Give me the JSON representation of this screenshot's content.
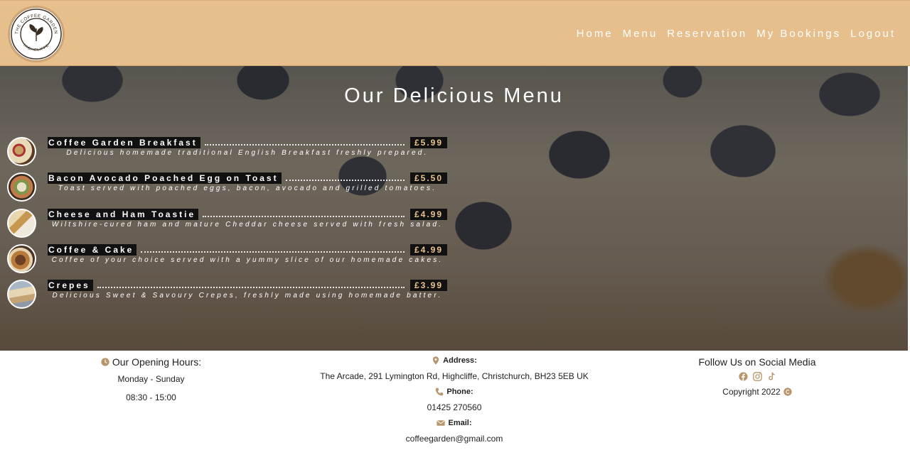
{
  "header": {
    "logo": {
      "top_text": "THE COFFEE GARDEN",
      "bottom_text": "HIGHCLIFFE",
      "icon": "leaf-icon"
    },
    "nav": [
      {
        "label": "Home"
      },
      {
        "label": "Menu"
      },
      {
        "label": "Reservation"
      },
      {
        "label": "My Bookings"
      },
      {
        "label": "Logout"
      }
    ]
  },
  "hero": {
    "title": "Our Delicious Menu",
    "items": [
      {
        "name": "Coffee Garden Breakfast",
        "price": "£5.99",
        "description": "Delicious homemade traditional English Breakfast freshly prepared."
      },
      {
        "name": "Bacon Avocado Poached Egg on Toast",
        "price": "£5.50",
        "description": "Toast served with poached eggs, bacon, avocado and grilled tomatoes."
      },
      {
        "name": "Cheese and Ham Toastie",
        "price": "£4.99",
        "description": "Wiltshire-cured ham and mature Cheddar cheese served with fresh salad."
      },
      {
        "name": "Coffee & Cake",
        "price": "£4.99",
        "description": "Coffee of your choice served with a yummy slice of our homemade cakes."
      },
      {
        "name": "Crepes",
        "price": "£3.99",
        "description": "Delicious Sweet & Savoury Crepes, freshly made using homemade batter."
      }
    ]
  },
  "footer": {
    "hours": {
      "title": "Our Opening Hours:",
      "days": "Monday - Sunday",
      "time": "08:30 - 15:00"
    },
    "address": {
      "label": "Address:",
      "value": "The Arcade, 291 Lymington Rd, Highcliffe, Christchurch, BH23 5EB UK"
    },
    "phone": {
      "label": "Phone:",
      "value": "01425 270560"
    },
    "email": {
      "label": "Email:",
      "value": "coffeegarden@gmail.com"
    },
    "social": {
      "title": "Follow Us on Social Media",
      "icons": [
        "facebook-icon",
        "instagram-icon",
        "tiktok-icon"
      ]
    },
    "copyright": "Copyright 2022"
  },
  "colors": {
    "header_bg": "#e6bf8c",
    "accent": "#b8956a",
    "price": "#e9c48f"
  }
}
